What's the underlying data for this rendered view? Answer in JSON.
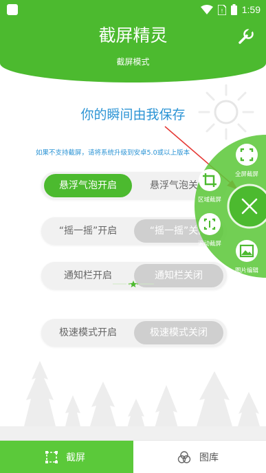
{
  "status_bar": {
    "time": "1:59"
  },
  "header": {
    "title": "截屏精灵",
    "subtitle": "截屏模式"
  },
  "headline": "你的瞬间由我保存",
  "notice": "如果不支持截屏，请将系统升级到安卓5.0或以上版本",
  "toggles": [
    {
      "on_label": "悬浮气泡开启",
      "off_label": "悬浮气泡关闭",
      "selected": "on"
    },
    {
      "on_label": "“摇一摇”开启",
      "off_label": "“摇一摇”关闭",
      "selected": "off"
    },
    {
      "on_label": "通知栏开启",
      "off_label": "通知栏关闭",
      "selected": "off"
    },
    {
      "on_label": "极速模式开启",
      "off_label": "极速模式关闭",
      "selected": "off"
    }
  ],
  "floating_menu": {
    "full_screen": "全屏截屏",
    "region": "区域截屏",
    "scroll": "滚动截屏",
    "edit": "图片编辑"
  },
  "bottom_nav": {
    "screenshot": "截屏",
    "gallery": "图库"
  },
  "colors": {
    "primary_green": "#4cba2f",
    "blue_text": "#2c94d5",
    "fab_green": "rgba(95,200,60,0.9)"
  }
}
